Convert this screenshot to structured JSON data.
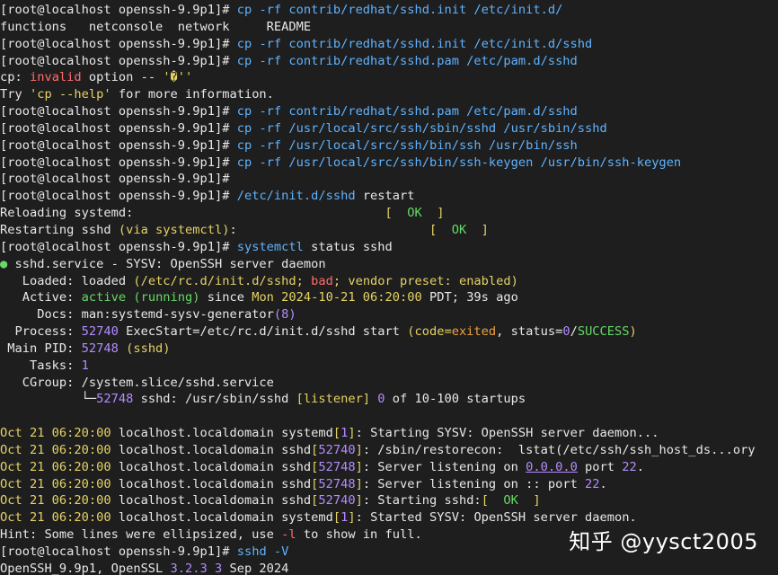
{
  "prompt": "[root@localhost openssh-9.9p1]#",
  "lines": [
    {
      "type": "cmd",
      "cmd": "cp",
      "args": "-rf contrib/redhat/sshd.init /etc/init.d/"
    },
    {
      "type": "text",
      "text": "functions   netconsole  network     README"
    },
    {
      "type": "cmd",
      "cmd": "cp",
      "args": "-rf contrib/redhat/sshd.init /etc/init.d/sshd"
    },
    {
      "type": "cmd",
      "cmd": "cp",
      "args": "-rf contrib/redhat/sshd.pam /etc/pam.d/sshd"
    },
    {
      "type": "err1",
      "a": "cp: ",
      "b": "invalid",
      "c": " option -- ",
      "d": "'�''"
    },
    {
      "type": "err2",
      "a": "Try ",
      "b": "'cp --help'",
      "c": " for more information."
    },
    {
      "type": "cmd",
      "cmd": "cp",
      "args": "-rf contrib/redhat/sshd.pam /etc/pam.d/sshd"
    },
    {
      "type": "cmd",
      "cmd": "cp",
      "args": "-rf /usr/local/src/ssh/sbin/sshd /usr/sbin/sshd"
    },
    {
      "type": "cmd",
      "cmd": "cp",
      "args": "-rf /usr/local/src/ssh/bin/ssh /usr/bin/ssh"
    },
    {
      "type": "cmd",
      "cmd": "cp",
      "args": "-rf /usr/local/src/ssh/bin/ssh-keygen /usr/bin/ssh-keygen"
    },
    {
      "type": "prompt"
    },
    {
      "type": "cmdw",
      "cmd": "/etc/init.d/sshd",
      "args": " restart"
    },
    {
      "type": "ok",
      "label": "Reloading systemd:",
      "pad": "                                  ",
      "ok": "OK"
    },
    {
      "type": "ok2",
      "label": "Restarting sshd ",
      "paren": "(via systemctl)",
      "tail": ":",
      "pad": "                          ",
      "ok": "OK"
    },
    {
      "type": "cmd",
      "cmd": "systemctl",
      "args": "status sshd",
      "argscolor": "white"
    },
    {
      "type": "status_head",
      "dot": "●",
      "text": " sshd.service - SYSV: OpenSSH server daemon"
    },
    {
      "type": "loaded",
      "key": "   Loaded:",
      "a": " loaded ",
      "b": "(/etc/rc.d/init.d/sshd; ",
      "bad": "bad",
      "c": "; vendor preset: enabled)"
    },
    {
      "type": "active",
      "key": "   Active:",
      "a": " active ",
      "b": "(running)",
      "c": " since ",
      "d": "Mon 2024-10-21 06:20:00",
      "e": " PDT; 39s ago"
    },
    {
      "type": "docs",
      "key": "     Docs:",
      "a": " man:systemd-sysv-generator",
      "b": "(8)"
    },
    {
      "type": "process",
      "key": "  Process:",
      "pid": " 52740",
      "a": " ExecStart=/etc/rc.d/init.d/sshd start ",
      "b": "(code=",
      "c": "exited",
      "d": ", status=",
      "e": "0",
      "f": "/",
      "g": "SUCCESS",
      "h": ")"
    },
    {
      "type": "mainpid",
      "key": " Main PID:",
      "pid": " 52748",
      "a": " (sshd)"
    },
    {
      "type": "tasks",
      "key": "    Tasks:",
      "v": " 1"
    },
    {
      "type": "cgroup",
      "key": "   CGroup:",
      "a": " /system.slice/sshd.service"
    },
    {
      "type": "tree",
      "pre": "           └─",
      "pid": "52748",
      "a": " sshd: /usr/sbin/sshd ",
      "b": "[listener] ",
      "c": "0",
      "d": " of 10-100 startups"
    },
    {
      "type": "blank"
    },
    {
      "type": "log",
      "date": "Oct 21 06:20:00",
      "host": " localhost.localdomain ",
      "proc": "systemd",
      "pid": "1",
      "msg": "]: Starting SYSV: OpenSSH server daemon..."
    },
    {
      "type": "log",
      "date": "Oct 21 06:20:00",
      "host": " localhost.localdomain ",
      "proc": "sshd",
      "pid": "52740",
      "msg": "]: /sbin/restorecon:  lstat(/etc/ssh/ssh_host_ds...ory"
    },
    {
      "type": "logip",
      "date": "Oct 21 06:20:00",
      "host": " localhost.localdomain ",
      "proc": "sshd",
      "pid": "52748",
      "a": "]: Server listening on ",
      "ip": "0.0.0.0",
      "b": " port ",
      "port": "22",
      "c": "."
    },
    {
      "type": "logip2",
      "date": "Oct 21 06:20:00",
      "host": " localhost.localdomain ",
      "proc": "sshd",
      "pid": "52748",
      "a": "]: Server listening on :: port ",
      "port": "22",
      "c": "."
    },
    {
      "type": "logok",
      "date": "Oct 21 06:20:00",
      "host": " localhost.localdomain ",
      "proc": "sshd",
      "pid": "52740",
      "a": "]: Starting sshd:[  ",
      "ok": "OK",
      "b": "  ]"
    },
    {
      "type": "log",
      "date": "Oct 21 06:20:00",
      "host": " localhost.localdomain ",
      "proc": "systemd",
      "pid": "1",
      "msg": "]: Started SYSV: OpenSSH server daemon."
    },
    {
      "type": "hint",
      "a": "Hint: Some lines were ellipsized, use ",
      "b": "-l",
      "c": " to show in full."
    },
    {
      "type": "cmd",
      "cmd": "sshd",
      "args": "-V"
    },
    {
      "type": "version",
      "a": "OpenSSH_9.9p1, OpenSSL ",
      "b": "3.2.3 3",
      "c": " Sep 2024"
    }
  ],
  "watermark": "知乎 @yysct2005"
}
